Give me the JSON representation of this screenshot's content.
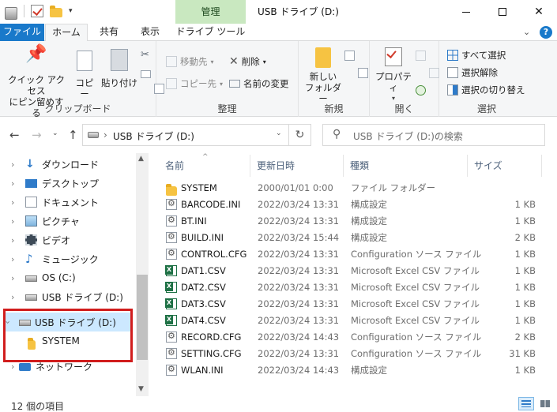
{
  "title_bar": {
    "context_tab": "管理",
    "window_title": "USB ドライブ (D:)",
    "quick_access_dropdown": "▾"
  },
  "ribbon_tabs": [
    "ファイル",
    "ホーム",
    "共有",
    "表示",
    "ドライブ ツール"
  ],
  "ribbon": {
    "clipboard": {
      "pin": "クイック アクセス\nにピン留めする",
      "copy": "コピー",
      "paste": "貼り付け",
      "group_label": "クリップボード"
    },
    "organize": {
      "move_to": "移動先",
      "copy_to": "コピー先",
      "delete": "削除",
      "rename": "名前の変更",
      "group_label": "整理"
    },
    "new": {
      "new_folder": "新しい\nフォルダー",
      "group_label": "新規"
    },
    "open": {
      "properties": "プロパティ",
      "group_label": "開く"
    },
    "select": {
      "select_all": "すべて選択",
      "select_none": "選択解除",
      "invert": "選択の切り替え",
      "group_label": "選択"
    }
  },
  "address": {
    "path": "USB ドライブ (D:)",
    "search_placeholder": "USB ドライブ (D:)の検索"
  },
  "nav_items": [
    {
      "label": "ダウンロード",
      "icon": "download-icon"
    },
    {
      "label": "デスクトップ",
      "icon": "desktop-icon"
    },
    {
      "label": "ドキュメント",
      "icon": "documents-icon"
    },
    {
      "label": "ピクチャ",
      "icon": "pictures-icon"
    },
    {
      "label": "ビデオ",
      "icon": "video-icon"
    },
    {
      "label": "ミュージック",
      "icon": "music-icon"
    },
    {
      "label": "OS (C:)",
      "icon": "drive-icon"
    },
    {
      "label": "USB ドライブ (D:)",
      "icon": "usb-drive-icon"
    },
    {
      "label": "USB ドライブ (D:)",
      "icon": "usb-drive-icon",
      "selected": true
    },
    {
      "label": "SYSTEM",
      "icon": "folder-icon"
    },
    {
      "label": "ネットワーク",
      "icon": "network-icon"
    }
  ],
  "columns": [
    "名前",
    "更新日時",
    "種類",
    "サイズ"
  ],
  "files": [
    {
      "name": "SYSTEM",
      "date": "2000/01/01 0:00",
      "type": "ファイル フォルダー",
      "size": "",
      "icon": "folder"
    },
    {
      "name": "BARCODE.INI",
      "date": "2022/03/24 13:31",
      "type": "構成設定",
      "size": "1 KB",
      "icon": "ini"
    },
    {
      "name": "BT.INI",
      "date": "2022/03/24 13:31",
      "type": "構成設定",
      "size": "1 KB",
      "icon": "ini"
    },
    {
      "name": "BUILD.INI",
      "date": "2022/03/24 15:44",
      "type": "構成設定",
      "size": "2 KB",
      "icon": "ini"
    },
    {
      "name": "CONTROL.CFG",
      "date": "2022/03/24 13:31",
      "type": "Configuration ソース ファイル",
      "size": "1 KB",
      "icon": "cfg"
    },
    {
      "name": "DAT1.CSV",
      "date": "2022/03/24 13:31",
      "type": "Microsoft Excel CSV ファイル",
      "size": "1 KB",
      "icon": "csv"
    },
    {
      "name": "DAT2.CSV",
      "date": "2022/03/24 13:31",
      "type": "Microsoft Excel CSV ファイル",
      "size": "1 KB",
      "icon": "csv"
    },
    {
      "name": "DAT3.CSV",
      "date": "2022/03/24 13:31",
      "type": "Microsoft Excel CSV ファイル",
      "size": "1 KB",
      "icon": "csv"
    },
    {
      "name": "DAT4.CSV",
      "date": "2022/03/24 13:31",
      "type": "Microsoft Excel CSV ファイル",
      "size": "1 KB",
      "icon": "csv"
    },
    {
      "name": "RECORD.CFG",
      "date": "2022/03/24 14:43",
      "type": "Configuration ソース ファイル",
      "size": "2 KB",
      "icon": "cfg"
    },
    {
      "name": "SETTING.CFG",
      "date": "2022/03/24 13:31",
      "type": "Configuration ソース ファイル",
      "size": "31 KB",
      "icon": "cfg"
    },
    {
      "name": "WLAN.INI",
      "date": "2022/03/24 14:43",
      "type": "構成設定",
      "size": "1 KB",
      "icon": "ini"
    }
  ],
  "status": {
    "item_count": "12 個の項目"
  },
  "colors": {
    "file_tab": "#1979ca",
    "context_tab": "#c9e8c0",
    "selection": "#cce8ff",
    "highlight_box": "#d11d1d",
    "folder": "#f6c342",
    "excel": "#1e7145"
  }
}
